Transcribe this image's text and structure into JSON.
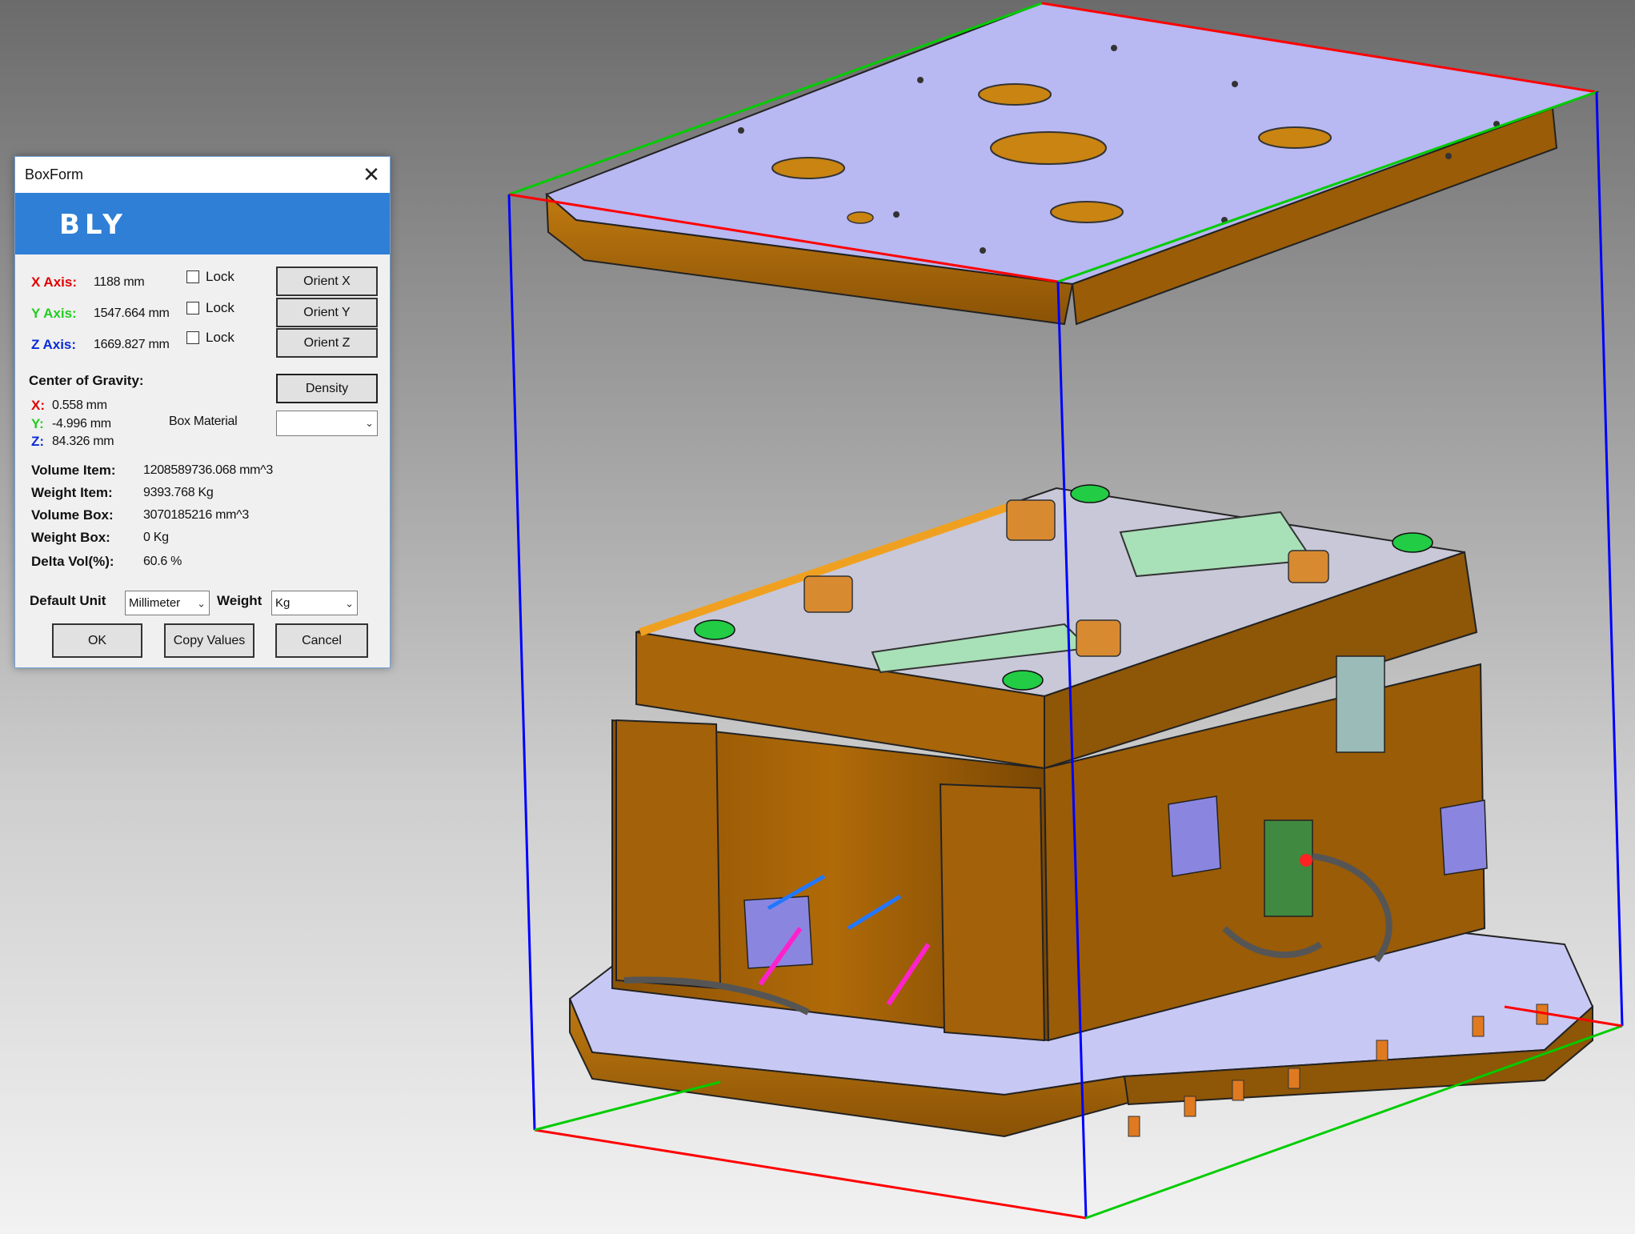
{
  "dialog": {
    "title": "BoxForm",
    "close_icon": "close-icon",
    "logo_text": "BLY",
    "accent_color": "#2f7fd6",
    "axes": [
      {
        "label": "X Axis:",
        "value": "1188 mm",
        "lock_label": "Lock",
        "lock_checked": false,
        "orient_label": "Orient X",
        "color": "#e00000"
      },
      {
        "label": "Y Axis:",
        "value": "1547.664 mm",
        "lock_label": "Lock",
        "lock_checked": false,
        "orient_label": "Orient Y",
        "color": "#22cc22"
      },
      {
        "label": "Z Axis:",
        "value": "1669.827 mm",
        "lock_label": "Lock",
        "lock_checked": false,
        "orient_label": "Orient Z",
        "color": "#0a2bd6"
      }
    ],
    "cog": {
      "title": "Center of Gravity:",
      "x_label": "X:",
      "x_value": "0.558 mm",
      "y_label": "Y:",
      "y_value": "-4.996 mm",
      "z_label": "Z:",
      "z_value": "84.326 mm"
    },
    "density_label": "Density",
    "box_material": {
      "label": "Box Material",
      "value": ""
    },
    "stats": [
      {
        "label": "Volume Item:",
        "value": "1208589736.068 mm^3"
      },
      {
        "label": "Weight Item:",
        "value": "9393.768 Kg"
      },
      {
        "label": "Volume Box:",
        "value": "3070185216 mm^3"
      },
      {
        "label": "Weight Box:",
        "value": "0 Kg"
      },
      {
        "label": "Delta Vol(%):",
        "value": "60.6 %"
      }
    ],
    "default_unit": {
      "label": "Default Unit",
      "value": "Millimeter"
    },
    "weight": {
      "label": "Weight",
      "value": "Kg"
    },
    "buttons": {
      "ok": "OK",
      "copy": "Copy Values",
      "cancel": "Cancel"
    }
  },
  "viewport": {
    "description_icon": "mold-assembly-3d-model",
    "bbox_colors": {
      "x": "#ff0000",
      "y": "#00cc00",
      "z": "#0000ff"
    },
    "plate_color": "#b8b8f2",
    "body_color": "#b06a08"
  }
}
